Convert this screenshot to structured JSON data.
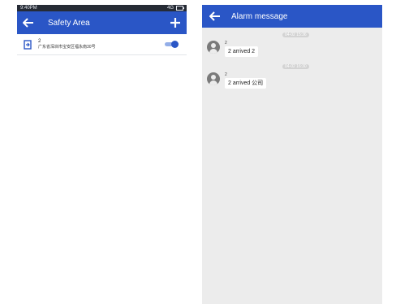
{
  "left_screen": {
    "statusbar": {
      "time": "9:40PM",
      "network": "4G"
    },
    "appbar": {
      "title": "Safety Area"
    },
    "areas": [
      {
        "name": "2",
        "address": "广东省深圳市宝安区福永南30号",
        "enabled": true
      }
    ]
  },
  "right_screen": {
    "appbar": {
      "title": "Alarm message"
    },
    "messages": [
      {
        "timestamp": "04-02 15:36",
        "sender": "2",
        "text": "2 arrived 2"
      },
      {
        "timestamp": "04-02 16:30",
        "sender": "2",
        "text": "2 arrived 公司"
      }
    ]
  },
  "colors": {
    "primary": "#2a56c6",
    "statusbar": "#262b35",
    "chat_bg": "#ececec",
    "avatar": "#7a7a7a"
  },
  "icons": [
    "back-arrow-icon",
    "plus-icon",
    "door-exit-icon",
    "battery-icon",
    "avatar-icon"
  ]
}
